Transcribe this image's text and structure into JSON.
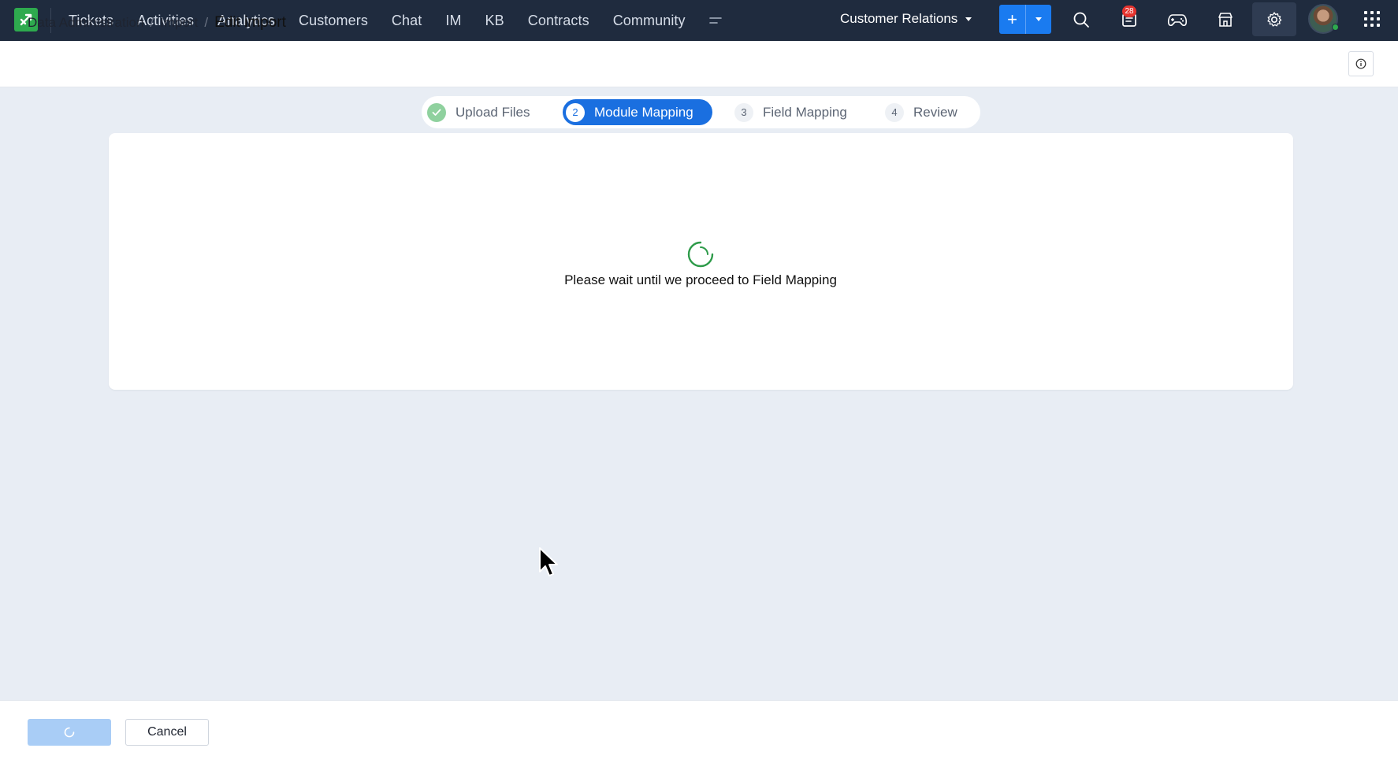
{
  "topbar": {
    "nav_items": [
      "Tickets",
      "Activities",
      "Analytics",
      "Customers",
      "Chat",
      "IM",
      "KB",
      "Contracts",
      "Community"
    ],
    "department": "Customer Relations",
    "notification_count": "28",
    "accent_color": "#1a7bf0",
    "brand_color": "#2eaa4e"
  },
  "breadcrumb": {
    "items": [
      "Data Administration",
      "Import"
    ],
    "current": "Edit import"
  },
  "stepper": {
    "steps": [
      {
        "number": "",
        "label": "Upload Files",
        "state": "done"
      },
      {
        "number": "2",
        "label": "Module Mapping",
        "state": "active"
      },
      {
        "number": "3",
        "label": "Field Mapping",
        "state": "pending"
      },
      {
        "number": "4",
        "label": "Review",
        "state": "pending"
      }
    ]
  },
  "main": {
    "wait_message": "Please wait until we proceed to Field Mapping"
  },
  "footer": {
    "cancel_label": "Cancel"
  }
}
